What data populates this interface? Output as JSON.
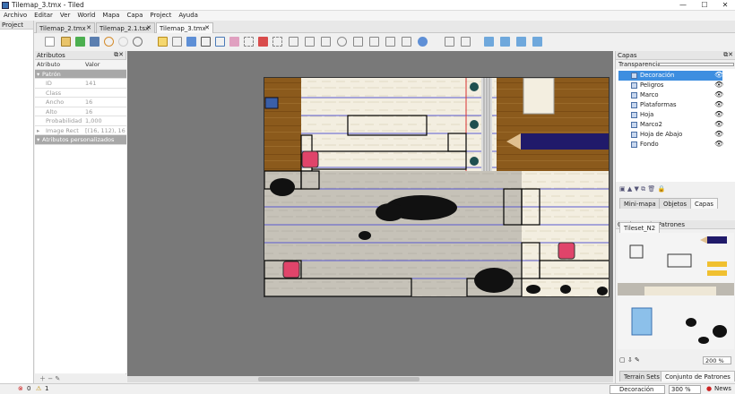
{
  "window": {
    "title": "Tilemap_3.tmx - Tiled",
    "minimize": "—",
    "maximize": "☐",
    "close": "✕"
  },
  "menu": [
    "Archivo",
    "Editar",
    "Ver",
    "World",
    "Mapa",
    "Capa",
    "Project",
    "Ayuda"
  ],
  "tabs": [
    {
      "label": "Tilemap_2.tmx"
    },
    {
      "label": "Tilemap_2.1.tsx"
    },
    {
      "label": "Tilemap_3.tmx"
    }
  ],
  "project_panel": {
    "title": "Project"
  },
  "attributes_panel": {
    "title": "Atributos",
    "col_attr": "Atributo",
    "col_value": "Valor",
    "group1": "Patrón",
    "rows": [
      {
        "k": "ID",
        "v": "141"
      },
      {
        "k": "Class",
        "v": ""
      },
      {
        "k": "Ancho",
        "v": "16"
      },
      {
        "k": "Alto",
        "v": "16"
      },
      {
        "k": "Probabilidad",
        "v": "1,000"
      },
      {
        "k": "Image Rect",
        "v": "[(16, 112), 16 x ..."
      }
    ],
    "group2": "Atributos personalizados"
  },
  "layers_panel": {
    "title": "Capas",
    "opacity_label": "Transparencia:",
    "layers": [
      {
        "name": "Decoración",
        "selected": true
      },
      {
        "name": "Peligros"
      },
      {
        "name": "Marco"
      },
      {
        "name": "Plataformas"
      },
      {
        "name": "Hoja"
      },
      {
        "name": "Marco2"
      },
      {
        "name": "Hoja de Abajo"
      },
      {
        "name": "Fondo"
      }
    ],
    "tabs": [
      "Mini-mapa",
      "Objetos",
      "Capas"
    ]
  },
  "tileset_panel": {
    "title": "Conjunto de Patrones",
    "tileset_tab": "Tileset_N2",
    "zoom": "200 %",
    "bottom_tabs": [
      "Terrain Sets",
      "Conjunto de Patrones"
    ]
  },
  "status": {
    "errors": "0",
    "warnings": "1",
    "layer_select": "Decoración",
    "zoom": "300 %",
    "news": "News"
  }
}
